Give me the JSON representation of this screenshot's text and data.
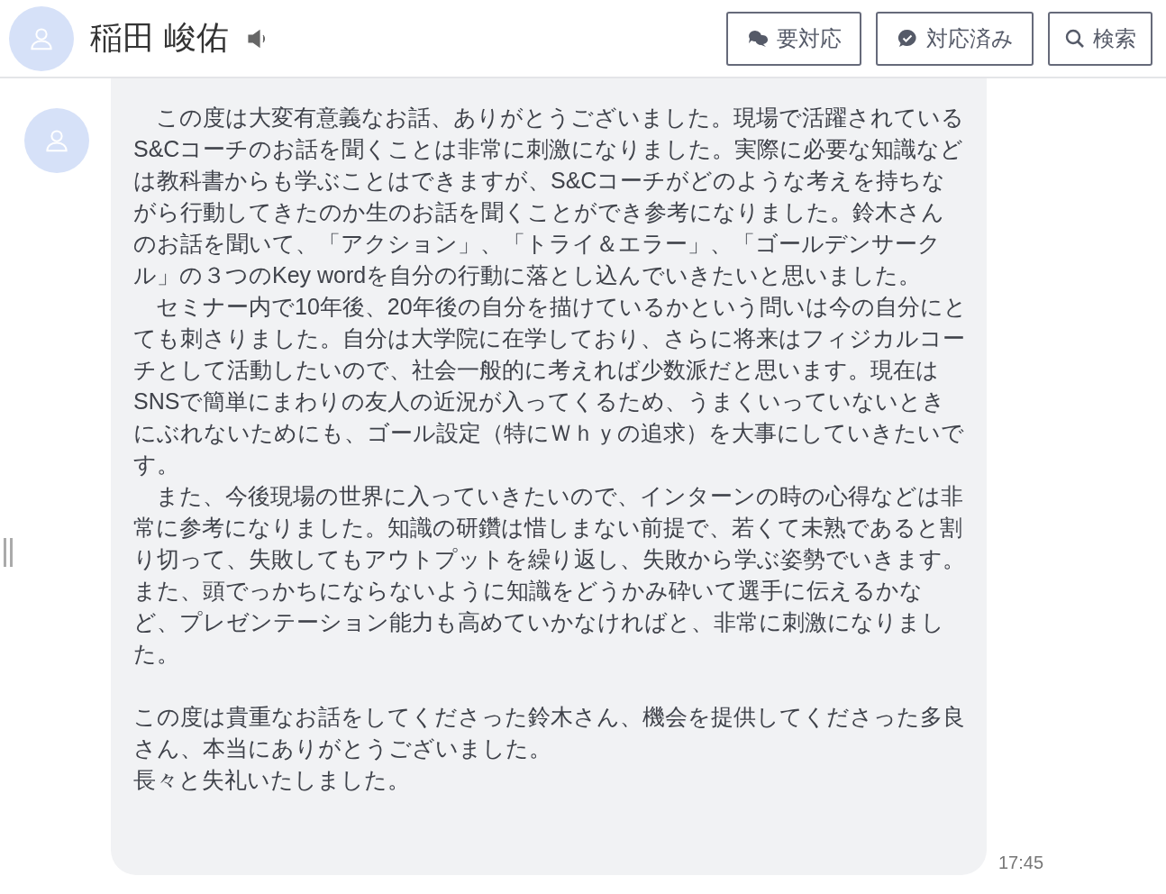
{
  "header": {
    "name": "稲田 峻佑",
    "buttons": [
      {
        "kind": "needs",
        "label": "要対応"
      },
      {
        "kind": "done",
        "label": "対応済み"
      },
      {
        "kind": "search",
        "label": "検索"
      }
    ]
  },
  "message": {
    "paragraphs": [
      "　この度は大変有意義なお話、ありがとうございました。現場で活躍されているS&Cコーチのお話を聞くことは非常に刺激になりました。実際に必要な知識などは教科書からも学ぶことはできますが、S&Cコーチがどのような考えを持ちながら行動してきたのか生のお話を聞くことができ参考になりました。鈴木さんのお話を聞いて、「アクション」、「トライ＆エラー」、「ゴールデンサークル」の３つのKey wordを自分の行動に落とし込んでいきたいと思いました。",
      "　セミナー内で10年後、20年後の自分を描けているかという問いは今の自分にとても刺さりました。自分は大学院に在学しており、さらに将来はフィジカルコーチとして活動したいので、社会一般的に考えれば少数派だと思います。現在はSNSで簡単にまわりの友人の近況が入ってくるため、うまくいっていないときにぶれないためにも、ゴール設定（特にＷｈｙの追求）を大事にしていきたいです。",
      "　また、今後現場の世界に入っていきたいので、インターンの時の心得などは非常に参考になりました。知識の研鑽は惜しまない前提で、若くて未熟であると割り切って、失敗してもアウトプットを繰り返し、失敗から学ぶ姿勢でいきます。また、頭でっかちにならないように知識をどうかみ砕いて選手に伝えるかなど、プレゼンテーション能力も高めていかなければと、非常に刺激になりました。"
    ],
    "closing": [
      "この度は貴重なお話をしてくださった鈴木さん、機会を提供してくださった多良さん、本当にありがとうございました。",
      "長々と失礼いたしました。"
    ],
    "time": "17:45"
  }
}
